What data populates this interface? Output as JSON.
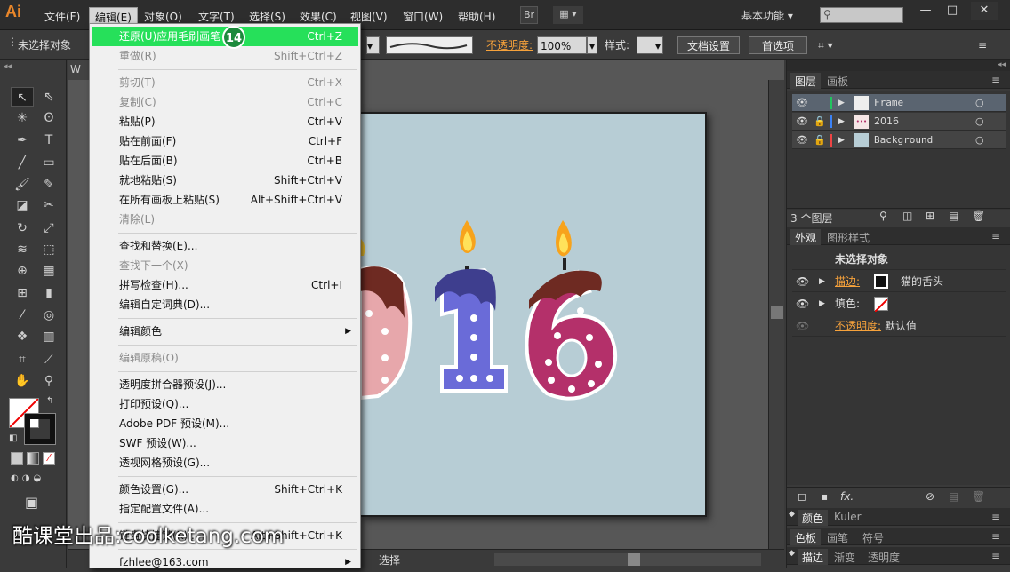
{
  "app": {
    "logo": "Ai",
    "workspace": "基本功能",
    "bridge": "Br"
  },
  "menubar": [
    "文件(F)",
    "编辑(E)",
    "对象(O)",
    "文字(T)",
    "选择(S)",
    "效果(C)",
    "视图(V)",
    "窗口(W)",
    "帮助(H)"
  ],
  "control": {
    "selection_label": "未选择对象",
    "opacity_label": "不透明度:",
    "opacity_value": "100%",
    "style_label": "样式:",
    "doc_setup": "文档设置",
    "prefs": "首选项"
  },
  "edit_menu": [
    {
      "label": "还原(U)应用毛刷画笔",
      "shortcut": "Ctrl+Z",
      "state": "highlight"
    },
    {
      "label": "重做(R)",
      "shortcut": "Shift+Ctrl+Z",
      "state": "disabled"
    },
    {
      "label": "剪切(T)",
      "shortcut": "Ctrl+X",
      "state": "disabled"
    },
    {
      "label": "复制(C)",
      "shortcut": "Ctrl+C",
      "state": "disabled"
    },
    {
      "label": "粘贴(P)",
      "shortcut": "Ctrl+V",
      "state": "normal"
    },
    {
      "label": "贴在前面(F)",
      "shortcut": "Ctrl+F",
      "state": "normal"
    },
    {
      "label": "贴在后面(B)",
      "shortcut": "Ctrl+B",
      "state": "normal"
    },
    {
      "label": "就地粘贴(S)",
      "shortcut": "Shift+Ctrl+V",
      "state": "normal"
    },
    {
      "label": "在所有画板上粘贴(S)",
      "shortcut": "Alt+Shift+Ctrl+V",
      "state": "normal"
    },
    {
      "label": "清除(L)",
      "shortcut": "",
      "state": "disabled"
    },
    {
      "label": "查找和替换(E)...",
      "shortcut": "",
      "state": "normal"
    },
    {
      "label": "查找下一个(X)",
      "shortcut": "",
      "state": "disabled"
    },
    {
      "label": "拼写检查(H)...",
      "shortcut": "Ctrl+I",
      "state": "normal"
    },
    {
      "label": "编辑自定词典(D)...",
      "shortcut": "",
      "state": "normal"
    },
    {
      "label": "编辑颜色",
      "shortcut": "",
      "state": "normal"
    },
    {
      "label": "编辑原稿(O)",
      "shortcut": "",
      "state": "disabled"
    },
    {
      "label": "透明度拼合器预设(J)...",
      "shortcut": "",
      "state": "normal"
    },
    {
      "label": "打印预设(Q)...",
      "shortcut": "",
      "state": "normal"
    },
    {
      "label": "Adobe PDF 预设(M)...",
      "shortcut": "",
      "state": "normal"
    },
    {
      "label": "SWF 预设(W)...",
      "shortcut": "",
      "state": "normal"
    },
    {
      "label": "透视网格预设(G)...",
      "shortcut": "",
      "state": "normal"
    },
    {
      "label": "颜色设置(G)...",
      "shortcut": "Shift+Ctrl+K",
      "state": "normal"
    },
    {
      "label": "指定配置文件(A)...",
      "shortcut": "",
      "state": "normal"
    },
    {
      "label": "键盘快捷键(K)...",
      "shortcut": "Alt+Shift+Ctrl+K",
      "state": "normal"
    },
    {
      "label": "fzhlee@163.com",
      "shortcut": "",
      "state": "normal"
    }
  ],
  "badge": "14",
  "layers_panel": {
    "tabs": [
      "图层",
      "画板"
    ],
    "layers": [
      {
        "name": "Frame",
        "color": "#22c55e"
      },
      {
        "name": "2016",
        "color": "#3b82f6"
      },
      {
        "name": "Background",
        "color": "#ef4444"
      }
    ],
    "count": "3 个图层"
  },
  "appearance_panel": {
    "tabs": [
      "外观",
      "图形样式"
    ],
    "title": "未选择对象",
    "stroke_label": "描边:",
    "stroke_value": "猫的舌头",
    "fill_label": "填色:",
    "opacity_label": "不透明度:",
    "opacity_value": "默认值"
  },
  "bottom_panels": {
    "row1": [
      "颜色",
      "Kuler"
    ],
    "row2": [
      "色板",
      "画笔",
      "符号"
    ],
    "row3": [
      "描边",
      "渐变",
      "透明度"
    ]
  },
  "status": {
    "tool": "选择",
    "doc_tab": "W"
  },
  "watermark": "酷课堂出品:coolketang.com",
  "artwork": {
    "digits": [
      "0",
      "1",
      "6"
    ]
  }
}
